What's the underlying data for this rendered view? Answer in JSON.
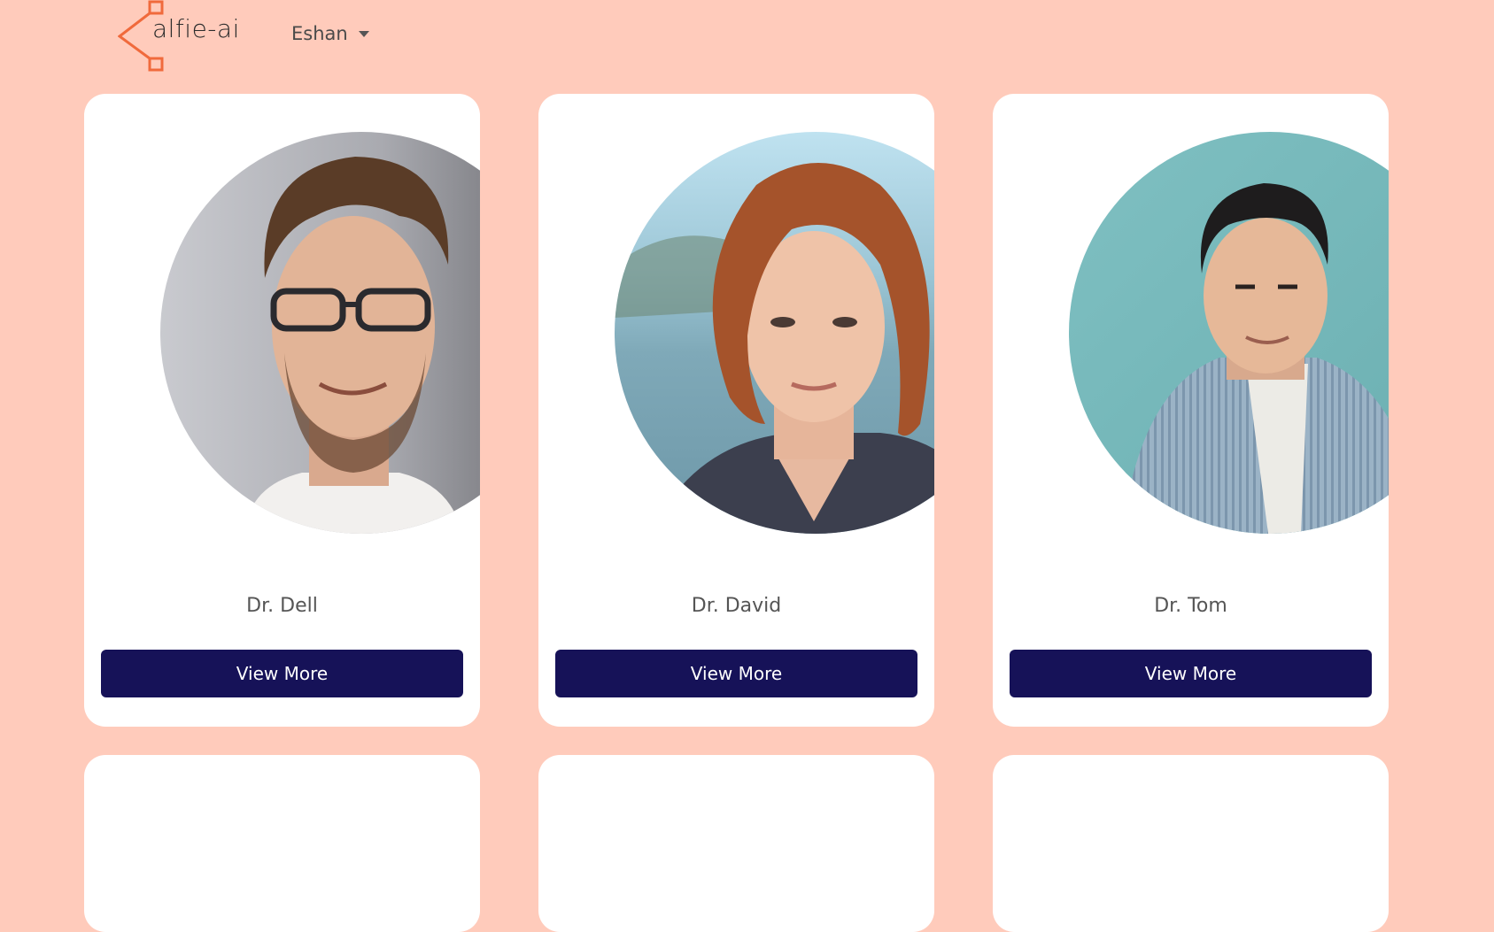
{
  "header": {
    "logo_text": "alfie-ai",
    "user_name": "Eshan"
  },
  "colors": {
    "background": "#ffcbbb",
    "card": "#ffffff",
    "button": "#161258",
    "logo_accent": "#f06a3c"
  },
  "doctors": [
    {
      "name": "Dr. Dell",
      "button_label": "View More"
    },
    {
      "name": "Dr. David",
      "button_label": "View More"
    },
    {
      "name": "Dr. Tom",
      "button_label": "View More"
    }
  ]
}
